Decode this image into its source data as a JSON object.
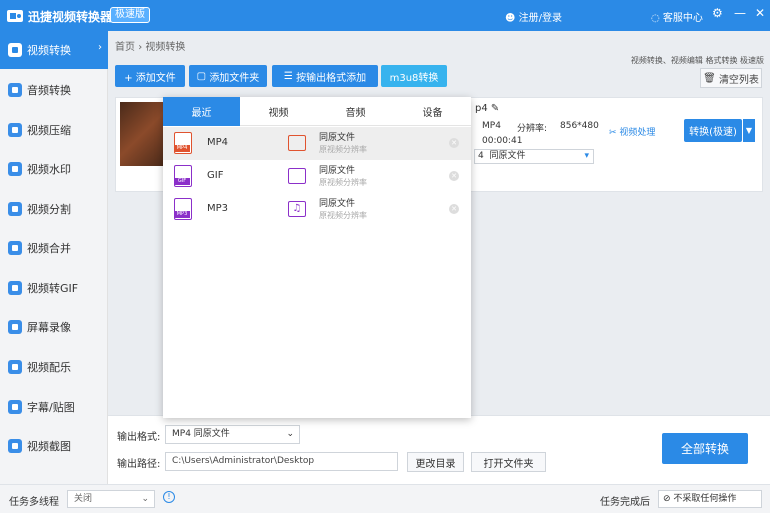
{
  "app": {
    "title": "迅捷视频转换器",
    "edition": "极速版"
  },
  "titlebar": {
    "user": "注册/登录",
    "service": "客服中心",
    "promo": "视频转换、视频编辑 格式转换 极速版"
  },
  "sidebar": {
    "items": [
      {
        "label": "视频转换",
        "icon": "video-convert-icon"
      },
      {
        "label": "音频转换",
        "icon": "audio-convert-icon"
      },
      {
        "label": "视频压缩",
        "icon": "compress-icon"
      },
      {
        "label": "视频水印",
        "icon": "watermark-icon"
      },
      {
        "label": "视频分割",
        "icon": "split-icon"
      },
      {
        "label": "视频合并",
        "icon": "merge-icon"
      },
      {
        "label": "视频转GIF",
        "icon": "gif-icon"
      },
      {
        "label": "屏幕录像",
        "icon": "screen-record-icon"
      },
      {
        "label": "视频配乐",
        "icon": "music-icon"
      },
      {
        "label": "字幕/贴图",
        "icon": "subtitle-icon"
      },
      {
        "label": "视频截图",
        "icon": "screenshot-icon"
      }
    ]
  },
  "breadcrumb": {
    "home": "首页",
    "sep": "›",
    "current": "视频转换"
  },
  "toolbar": {
    "add_file": "+ 添加文件",
    "add_folder": "添加文件夹",
    "by_format": "按输出格式添加",
    "m3u8": "m3u8转换",
    "clear": "清空列表"
  },
  "file": {
    "name_suffix": "p4",
    "format": "MP4",
    "res_label": "分辨率:",
    "res": "856*480",
    "duration": "00:00:41",
    "out_fmt": "4",
    "out_quality": "同原文件",
    "video_proc": "视频处理",
    "convert": "转换(极速)"
  },
  "popup": {
    "tabs": [
      "最近",
      "视频",
      "音频",
      "设备"
    ],
    "rows": [
      {
        "name": "MP4",
        "tag": "MP4",
        "quality": "同原文件",
        "sub": "原视频分辨率"
      },
      {
        "name": "GIF",
        "tag": "GIF",
        "quality": "同原文件",
        "sub": "原视频分辨率"
      },
      {
        "name": "MP3",
        "tag": "MP3",
        "quality": "同原文件",
        "sub": "原视频分辨率"
      }
    ]
  },
  "output": {
    "format_label": "输出格式:",
    "format_value": "MP4  同原文件",
    "path_label": "输出路径:",
    "path_value": "C:\\Users\\Administrator\\Desktop",
    "change_dir": "更改目录",
    "open_folder": "打开文件夹",
    "convert_all": "全部转换"
  },
  "status": {
    "multitask_label": "任务多线程",
    "multitask_value": "关闭",
    "done_label": "任务完成后",
    "done_value": "不采取任何操作"
  }
}
